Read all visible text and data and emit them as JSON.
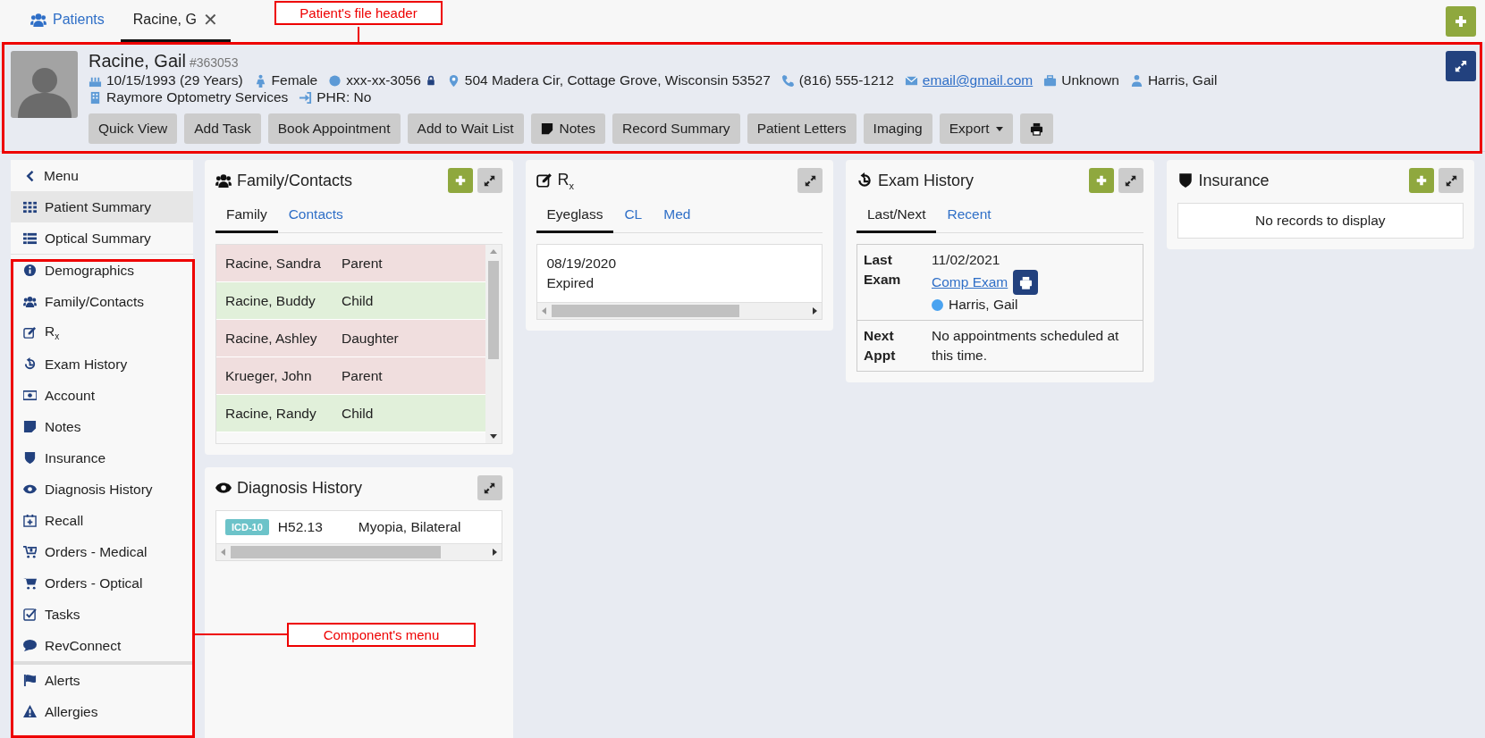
{
  "top_tabs": [
    {
      "label": "Patients",
      "kind": "link",
      "selected": false
    },
    {
      "label": "Racine, G",
      "kind": "closable",
      "selected": true,
      "close": "✕"
    }
  ],
  "patient": {
    "name": "Racine, Gail",
    "id": "#363053",
    "info_line": [
      {
        "kind": "dob",
        "text": "10/15/1993 (29 Years)"
      },
      {
        "kind": "gender",
        "text": "Female"
      },
      {
        "kind": "ssn",
        "text": "xxx-xx-3056"
      },
      {
        "kind": "address",
        "text": "504 Madera Cir, Cottage Grove, Wisconsin 53527"
      },
      {
        "kind": "phone",
        "text": "(816) 555-1212"
      },
      {
        "kind": "email",
        "text": "email@gmail.com"
      },
      {
        "kind": "employer",
        "text": "Unknown"
      },
      {
        "kind": "provider",
        "text": "Harris, Gail"
      }
    ],
    "info_line_2": [
      {
        "kind": "practice",
        "text": "Raymore Optometry Services"
      },
      {
        "kind": "phr",
        "text": "PHR: No"
      }
    ],
    "buttons": [
      {
        "kind": "plain",
        "label": "Quick View"
      },
      {
        "kind": "plain",
        "label": "Add Task"
      },
      {
        "kind": "plain",
        "label": "Book Appointment"
      },
      {
        "kind": "plain",
        "label": "Add to Wait List"
      },
      {
        "kind": "notes",
        "label": "Notes"
      },
      {
        "kind": "plain",
        "label": "Record Summary"
      },
      {
        "kind": "plain",
        "label": "Patient Letters"
      },
      {
        "kind": "plain",
        "label": "Imaging"
      },
      {
        "kind": "dropdown",
        "label": "Export"
      },
      {
        "kind": "print"
      }
    ]
  },
  "sidebar": {
    "back": "Menu",
    "sections": [
      {
        "items": [
          {
            "label": "Patient Summary",
            "selected": true
          },
          {
            "label": "Optical Summary",
            "selected": false
          }
        ]
      },
      {
        "items": [
          {
            "label": "Demographics",
            "selected": false
          },
          {
            "label": "Family/Contacts",
            "selected": false
          },
          {
            "label": "R$_{x}$",
            "selected": false
          },
          {
            "label": "Exam History",
            "selected": false
          },
          {
            "label": "Account",
            "selected": false
          },
          {
            "label": "Notes",
            "selected": false
          },
          {
            "label": "Insurance",
            "selected": false
          },
          {
            "label": "Diagnosis History",
            "selected": false
          },
          {
            "label": "Recall",
            "selected": false
          },
          {
            "label": "Orders - Medical",
            "selected": false
          },
          {
            "label": "Orders - Optical",
            "selected": false
          },
          {
            "label": "Tasks",
            "selected": false
          },
          {
            "label": "RevConnect",
            "selected": false
          }
        ]
      },
      {
        "items": [
          {
            "label": "Alerts",
            "selected": false
          },
          {
            "label": "Allergies",
            "selected": false
          }
        ]
      }
    ]
  },
  "panels": [
    {
      "kind": "family",
      "title": "Family/Contacts",
      "add": true,
      "tabs": [
        {
          "label": "Family",
          "selected": true
        },
        {
          "label": "Contacts",
          "selected": false
        }
      ],
      "rows": [
        {
          "name": "Racine, Sandra",
          "relation": "Parent",
          "color": "#f0dede"
        },
        {
          "name": "Racine, Buddy",
          "relation": "Child",
          "color": "#e1f0da"
        },
        {
          "name": "Racine, Ashley",
          "relation": "Daughter",
          "color": "#f0dede"
        },
        {
          "name": "Krueger, John",
          "relation": "Parent",
          "color": "#f0dede"
        },
        {
          "name": "Racine, Randy",
          "relation": "Child",
          "color": "#e1f0da"
        }
      ]
    },
    {
      "kind": "rx",
      "title": "R$_{x}$",
      "add": false,
      "tabs": [
        {
          "label": "Eyeglass",
          "selected": true
        },
        {
          "label": "CL",
          "selected": false
        },
        {
          "label": "Med",
          "selected": false
        }
      ],
      "card": {
        "date": "08/19/2020",
        "status": "Expired"
      }
    },
    {
      "kind": "exam",
      "title": "Exam History",
      "add": true,
      "tabs": [
        {
          "label": "Last/Next",
          "selected": true
        },
        {
          "label": "Recent",
          "selected": false
        }
      ],
      "last": {
        "label": "Last Exam",
        "date": "11/02/2021",
        "link": "Comp Exam",
        "provider": "Harris, Gail",
        "color": "#4aa3f0"
      },
      "next": {
        "label": "Next Appt",
        "text": "No appointments scheduled at this time."
      }
    },
    {
      "kind": "insurance",
      "title": "Insurance",
      "add": true,
      "empty": "No records to display"
    },
    {
      "kind": "diagnosis",
      "title": "Diagnosis History",
      "add": false,
      "rows": [
        {
          "badge": "ICD-10",
          "code": "H52.13",
          "description": "Myopia, Bilateral"
        }
      ]
    }
  ],
  "annotations": [
    {
      "kind": "header",
      "text": "Patient's file header"
    },
    {
      "kind": "menu",
      "text": "Component's menu"
    }
  ]
}
